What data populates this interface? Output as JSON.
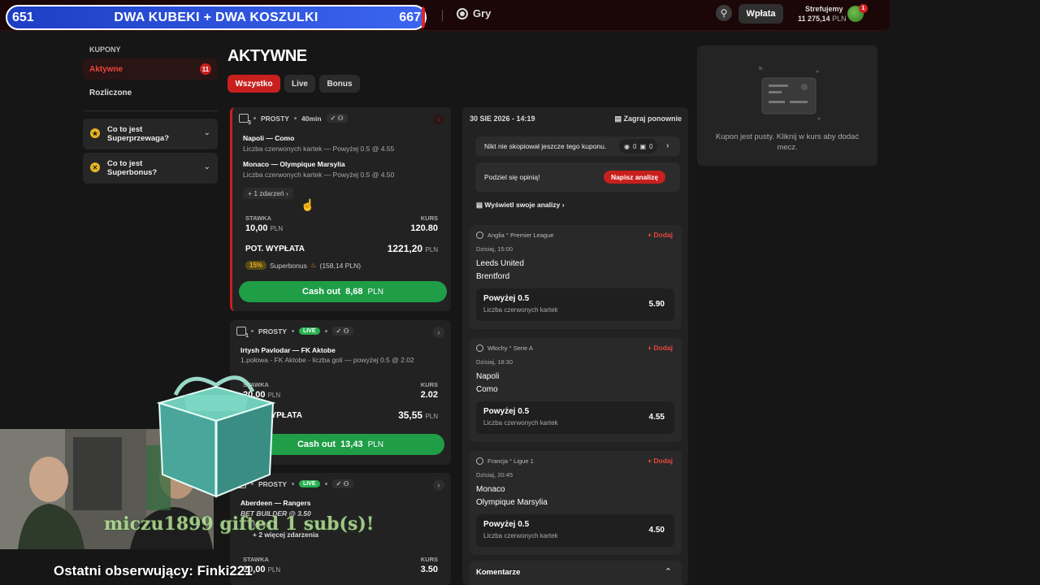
{
  "overlay": {
    "goal": {
      "left_num": "651",
      "title": "DWA KUBEKI + DWA KOSZULKI",
      "right_num": "667"
    },
    "gift_text": "miczu1899 gifted 1 sub(s)!",
    "follower_text": "Ostatni obserwujący: Finki221"
  },
  "topbar": {
    "games_label": "Gry",
    "deposit_label": "Wpłata",
    "account_name": "Strefujemy",
    "balance": "11 275,14",
    "currency": "PLN",
    "notifications": "1"
  },
  "sidebar": {
    "heading": "KUPONY",
    "items": [
      {
        "label": "Aktywne",
        "count": "11"
      },
      {
        "label": "Rozliczone"
      }
    ],
    "faq": [
      {
        "label": "Co to jest Superprzewaga?"
      },
      {
        "label": "Co to jest Superbonus?"
      }
    ]
  },
  "main": {
    "title": "AKTYWNE",
    "tabs": [
      {
        "label": "Wszystko"
      },
      {
        "label": "Live"
      },
      {
        "label": "Bonus"
      }
    ]
  },
  "bets": [
    {
      "events": "3",
      "type": "PROSTY",
      "time": "40min",
      "matches": [
        {
          "title": "Napoli — Como",
          "sub": "Liczba czerwonych kartek — Powyżej 0.5 @ 4.55"
        },
        {
          "title": "Monaco — Olympique Marsylia",
          "sub": "Liczba czerwonych kartek — Powyżej 0.5 @ 4.50"
        }
      ],
      "more": "+ 1 zdarzeń",
      "stake_label": "STAWKA",
      "stake": "10,00",
      "odds_label": "KURS",
      "odds": "120.80",
      "payout_label": "POT. WYPŁATA",
      "payout": "1221,20",
      "bonus_pct": "15%",
      "bonus_label": "Superbonus",
      "bonus_value": "(158,14 PLN)",
      "cashout_label": "Cash out",
      "cashout_value": "8,68",
      "currency": "PLN"
    },
    {
      "events": "1",
      "type": "PROSTY",
      "live": "LIVE",
      "matches": [
        {
          "title": "Irtysh Pavlodar — FK Aktobe",
          "sub": "1.połowa - FK Aktobe - liczba goli — powyżej 0.5 @ 2.02"
        }
      ],
      "stake_label": "STAWKA",
      "stake": "20,00",
      "odds_label": "KURS",
      "odds": "2.02",
      "payout_label": "POT. WYPŁATA",
      "payout": "35,55",
      "cashout_label": "Cash out",
      "cashout_value": "13,43",
      "currency": "PLN"
    },
    {
      "type": "PROSTY",
      "live": "LIVE",
      "matches": [
        {
          "title": "Aberdeen — Rangers",
          "sub": "BET BUILDER @ 3.50"
        }
      ],
      "extra1": "Mecz: 2",
      "extra2": "+ 2 więcej zdarzenia",
      "stake_label": "STAWKA",
      "stake": "20,00",
      "odds_label": "KURS",
      "odds": "3.50",
      "currency": "PLN"
    }
  ],
  "detail": {
    "date": "30 SIE 2026 - 14:19",
    "replay": "Zagraj ponownie",
    "nocopy": "Nikt nie skopiował jeszcze tego kuponu.",
    "views": "0",
    "copies": "0",
    "share": "Podziel się opinią!",
    "analyze_btn": "Napisz analizę",
    "show_analyses": "Wyświetl swoje analizy",
    "matches": [
      {
        "league": "Anglia ° Premier League",
        "time": "Dzisiaj, 15:00",
        "home": "Leeds United",
        "away": "Brentford",
        "sel": "Powyżej 0.5",
        "desc": "Liczba czerwonych kartek",
        "odds": "5.90",
        "add": "Dodaj"
      },
      {
        "league": "Włochy ° Serie A",
        "time": "Dzisiaj, 18:30",
        "home": "Napoli",
        "away": "Como",
        "sel": "Powyżej 0.5",
        "desc": "Liczba czerwonych kartek",
        "odds": "4.55",
        "add": "Dodaj"
      },
      {
        "league": "Francja ° Ligue 1",
        "time": "Dzisiaj, 20:45",
        "home": "Monaco",
        "away": "Olympique Marsylia",
        "sel": "Powyżej 0.5",
        "desc": "Liczba czerwonych kartek",
        "odds": "4.50",
        "add": "Dodaj"
      }
    ],
    "comments": "Komentarze"
  },
  "betslip": {
    "empty_text": "Kupon jest pusty. Kliknij w kurs aby dodać mecz."
  }
}
